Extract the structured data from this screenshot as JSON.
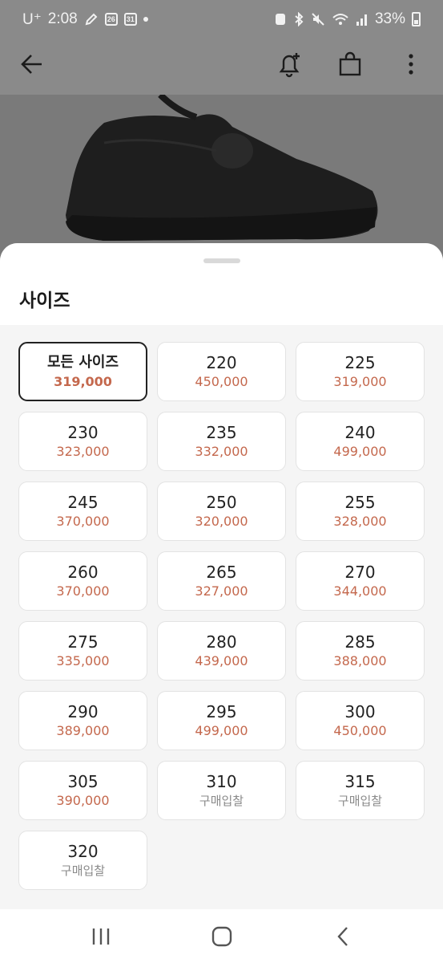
{
  "status_bar": {
    "carrier": "U⁺",
    "time": "2:08",
    "calendar_day_a": "26",
    "calendar_day_b": "31",
    "battery_percent": "33%"
  },
  "app_bar": {
    "back_icon": "arrow-left-icon",
    "alert_icon": "bell-plus-icon",
    "cart_icon": "shopping-bag-icon",
    "menu_icon": "more-vertical-icon"
  },
  "sheet": {
    "title": "사이즈",
    "sizes": [
      {
        "label": "모든 사이즈",
        "price": "319,000",
        "selected": true
      },
      {
        "label": "220",
        "price": "450,000"
      },
      {
        "label": "225",
        "price": "319,000"
      },
      {
        "label": "230",
        "price": "323,000"
      },
      {
        "label": "235",
        "price": "332,000"
      },
      {
        "label": "240",
        "price": "499,000"
      },
      {
        "label": "245",
        "price": "370,000"
      },
      {
        "label": "250",
        "price": "320,000"
      },
      {
        "label": "255",
        "price": "328,000"
      },
      {
        "label": "260",
        "price": "370,000"
      },
      {
        "label": "265",
        "price": "327,000"
      },
      {
        "label": "270",
        "price": "344,000"
      },
      {
        "label": "275",
        "price": "335,000"
      },
      {
        "label": "280",
        "price": "439,000"
      },
      {
        "label": "285",
        "price": "388,000"
      },
      {
        "label": "290",
        "price": "389,000"
      },
      {
        "label": "295",
        "price": "499,000"
      },
      {
        "label": "300",
        "price": "450,000"
      },
      {
        "label": "305",
        "price": "390,000"
      },
      {
        "label": "310",
        "price": "구매입찰",
        "no_price": true
      },
      {
        "label": "315",
        "price": "구매입찰",
        "no_price": true
      },
      {
        "label": "320",
        "price": "구매입찰",
        "no_price": true
      }
    ]
  },
  "colors": {
    "price": "#c4684d",
    "no_price": "#8a8a8a",
    "selected_border": "#222222"
  }
}
